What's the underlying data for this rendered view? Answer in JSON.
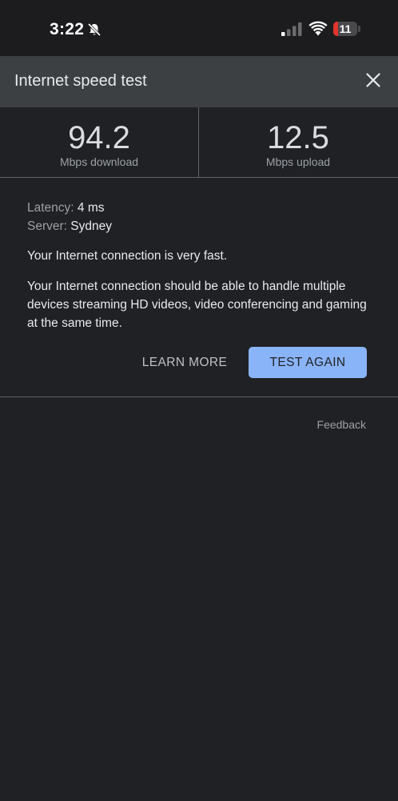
{
  "status_bar": {
    "time": "3:22",
    "battery_level": "11",
    "battery_color": "#e0342c"
  },
  "header": {
    "title": "Internet speed test",
    "close_icon": "close-icon"
  },
  "results": {
    "download": {
      "value": "94.2",
      "unit": "Mbps download"
    },
    "upload": {
      "value": "12.5",
      "unit": "Mbps upload"
    }
  },
  "details": {
    "latency_label": "Latency:",
    "latency_value": "4 ms",
    "server_label": "Server:",
    "server_value": "Sydney",
    "summary": "Your Internet connection is very fast.",
    "description": "Your Internet connection should be able to handle multiple devices streaming HD videos, video conferencing and gaming at the same time."
  },
  "actions": {
    "learn_more_label": "LEARN MORE",
    "test_again_label": "TEST AGAIN",
    "accent_color": "#8ab4f8"
  },
  "footer": {
    "feedback_label": "Feedback"
  }
}
